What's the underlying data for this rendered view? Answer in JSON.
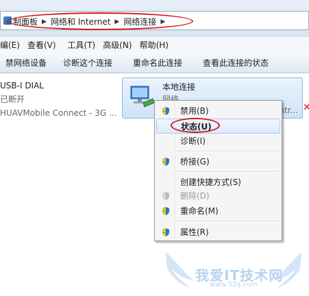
{
  "address_bar": {
    "crumbs": [
      "制面板",
      "网络和 Internet",
      "网络连接"
    ]
  },
  "menubar": {
    "items": [
      "编(E)",
      "查看(V)",
      "工具(T)",
      "高级(N)",
      "帮助(H)"
    ]
  },
  "toolbar": {
    "items": [
      "禁网络设备",
      "诊断这个连接",
      "重命名此连接",
      "查看此连接的状态"
    ]
  },
  "connections": {
    "first": {
      "name": "USB-I DIAL",
      "status": "已断开",
      "device": "HUAVMobile Connect - 3G ..."
    },
    "selected": {
      "name": "本地连接",
      "status": "网络",
      "device_truncated": "ntr..."
    }
  },
  "context_menu": {
    "items": [
      {
        "label": "禁用(B)",
        "icon": "uac-shield-icon"
      },
      {
        "label": "状态(U)",
        "icon": "",
        "bold": true,
        "highlighted": true
      },
      {
        "label": "诊断(I)",
        "icon": ""
      },
      {
        "label": "桥接(G)",
        "icon": "uac-shield-icon"
      },
      {
        "label": "创建快捷方式(S)",
        "icon": ""
      },
      {
        "label": "删除(D)",
        "icon": "uac-shield-icon",
        "disabled": true
      },
      {
        "label": "重命名(M)",
        "icon": "uac-shield-icon"
      },
      {
        "label": "属性(R)",
        "icon": "uac-shield-icon"
      }
    ]
  },
  "watermark": {
    "text": "我爱IT技术网",
    "url": "www.52ij.com"
  },
  "colors": {
    "annotation_red": "#d11a1a",
    "highlight_blue": "#a9c7ef"
  }
}
